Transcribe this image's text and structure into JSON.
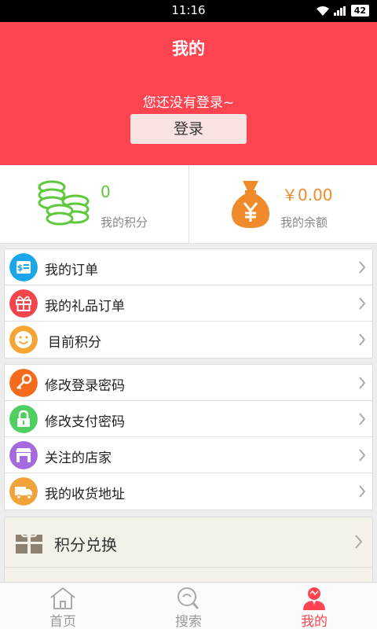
{
  "status_bar": {
    "time": "11:16",
    "battery": "42"
  },
  "header": {
    "title": "我的",
    "notice": "您还没有登录~",
    "login_label": "登录"
  },
  "stats": {
    "points": {
      "value": "0",
      "label": "我的积分"
    },
    "balance": {
      "value": "￥0.00",
      "label": "我的余额"
    }
  },
  "menu_groups": [
    [
      {
        "label": "我的订单",
        "icon": "receipt-icon",
        "color": "#1aa6e8"
      },
      {
        "label": "我的礼品订单",
        "icon": "gift-icon",
        "color": "#f2454c"
      },
      {
        "label": "目前积分",
        "icon": "smiley-icon",
        "color": "#f7a532"
      }
    ],
    [
      {
        "label": "修改登录密码",
        "icon": "key-icon",
        "color": "#f56b1e"
      },
      {
        "label": "修改支付密码",
        "icon": "lock-icon",
        "color": "#4fcf62"
      },
      {
        "label": "关注的店家",
        "icon": "store-icon",
        "color": "#a66ae0"
      },
      {
        "label": "我的收货地址",
        "icon": "truck-icon",
        "color": "#f2a23a"
      }
    ]
  ],
  "exchange": {
    "label": "积分兑换",
    "icon": "gift-box-icon"
  },
  "tabs": [
    {
      "label": "首页",
      "icon": "home-icon",
      "active": false
    },
    {
      "label": "搜索",
      "icon": "search-icon",
      "active": false
    },
    {
      "label": "我的",
      "icon": "user-icon",
      "active": true
    }
  ],
  "colors": {
    "brand": "#fd4450",
    "points_green": "#5ec93c",
    "balance_orange": "#f08a2a"
  }
}
